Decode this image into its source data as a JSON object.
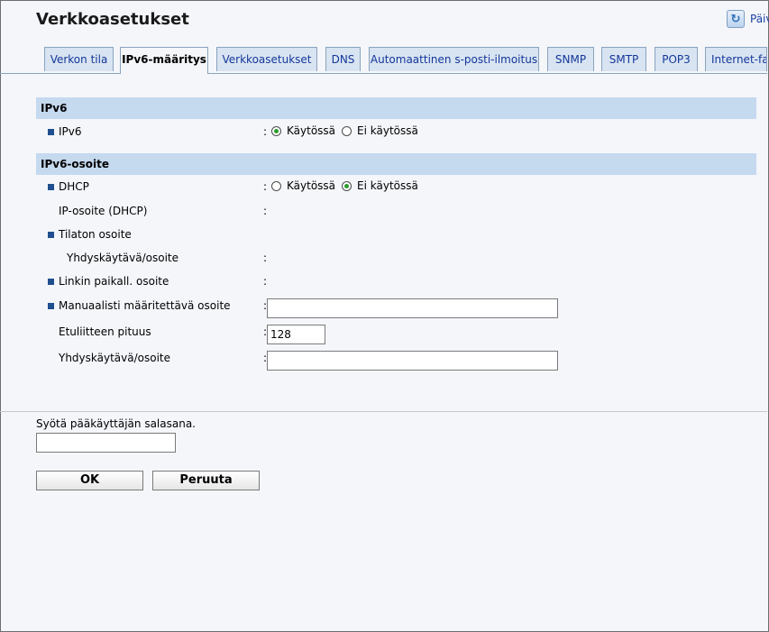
{
  "header": {
    "title": "Verkkoasetukset",
    "refresh_label": "Päivitä"
  },
  "tabs": [
    {
      "label": "Verkon tila",
      "active": false
    },
    {
      "label": "IPv6-määritys",
      "active": true
    },
    {
      "label": "Verkkoasetukset",
      "active": false
    },
    {
      "label": "DNS",
      "active": false
    },
    {
      "label": "Automaattinen s-posti-ilmoitus",
      "active": false
    },
    {
      "label": "SNMP",
      "active": false
    },
    {
      "label": "SMTP",
      "active": false
    },
    {
      "label": "POP3",
      "active": false
    },
    {
      "label": "Internet-faksi",
      "active": false
    }
  ],
  "sections": {
    "ipv6": {
      "title": "IPv6",
      "ipv6_label": "IPv6",
      "enabled_label": "Käytössä",
      "disabled_label": "Ei käytössä",
      "value": "enabled"
    },
    "ipv6_address": {
      "title": "IPv6-osoite",
      "dhcp_label": "DHCP",
      "dhcp_enabled_label": "Käytössä",
      "dhcp_disabled_label": "Ei käytössä",
      "dhcp_value": "disabled",
      "ip_dhcp_label": "IP-osoite (DHCP)",
      "stateless_label": "Tilaton osoite",
      "stateless_gateway_label": "Yhdyskäytävä/osoite",
      "link_local_label": "Linkin paikall. osoite",
      "manual_label": "Manuaalisti määritettävä osoite",
      "manual_value": "",
      "prefix_label": "Etuliitteen pituus",
      "prefix_value": "128",
      "gateway_label": "Yhdyskäytävä/osoite",
      "gateway_value": ""
    }
  },
  "footer": {
    "password_prompt": "Syötä pääkäyttäjän salasana.",
    "password_value": "",
    "ok_label": "OK",
    "cancel_label": "Peruuta"
  },
  "colon": ":"
}
